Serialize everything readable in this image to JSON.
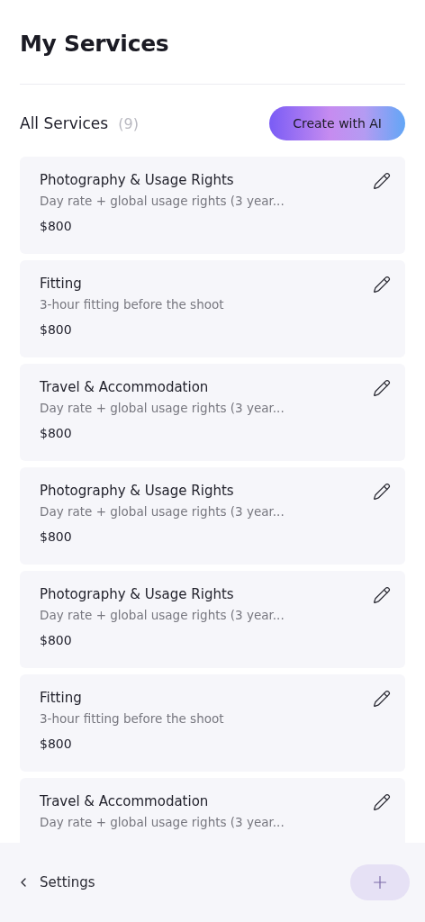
{
  "title": "My Services",
  "section": {
    "label": "All Services",
    "count": "(9)",
    "action": "Create with AI"
  },
  "services": [
    {
      "name": "Photography & Usage Rights",
      "description": "Day rate + global usage rights (3 year...",
      "price": "$800"
    },
    {
      "name": "Fitting",
      "description": "3-hour fitting before the shoot",
      "price": "$800"
    },
    {
      "name": "Travel & Accommodation",
      "description": "Day rate + global usage rights (3 year...",
      "price": "$800"
    },
    {
      "name": "Photography & Usage Rights",
      "description": "Day rate + global usage rights (3 year...",
      "price": "$800"
    },
    {
      "name": "Photography & Usage Rights",
      "description": "Day rate + global usage rights (3 year...",
      "price": "$800"
    },
    {
      "name": "Fitting",
      "description": "3-hour fitting before the shoot",
      "price": "$800"
    },
    {
      "name": "Travel & Accommodation",
      "description": "Day rate + global usage rights (3 year..."
    }
  ],
  "footer": {
    "back": "Settings"
  }
}
